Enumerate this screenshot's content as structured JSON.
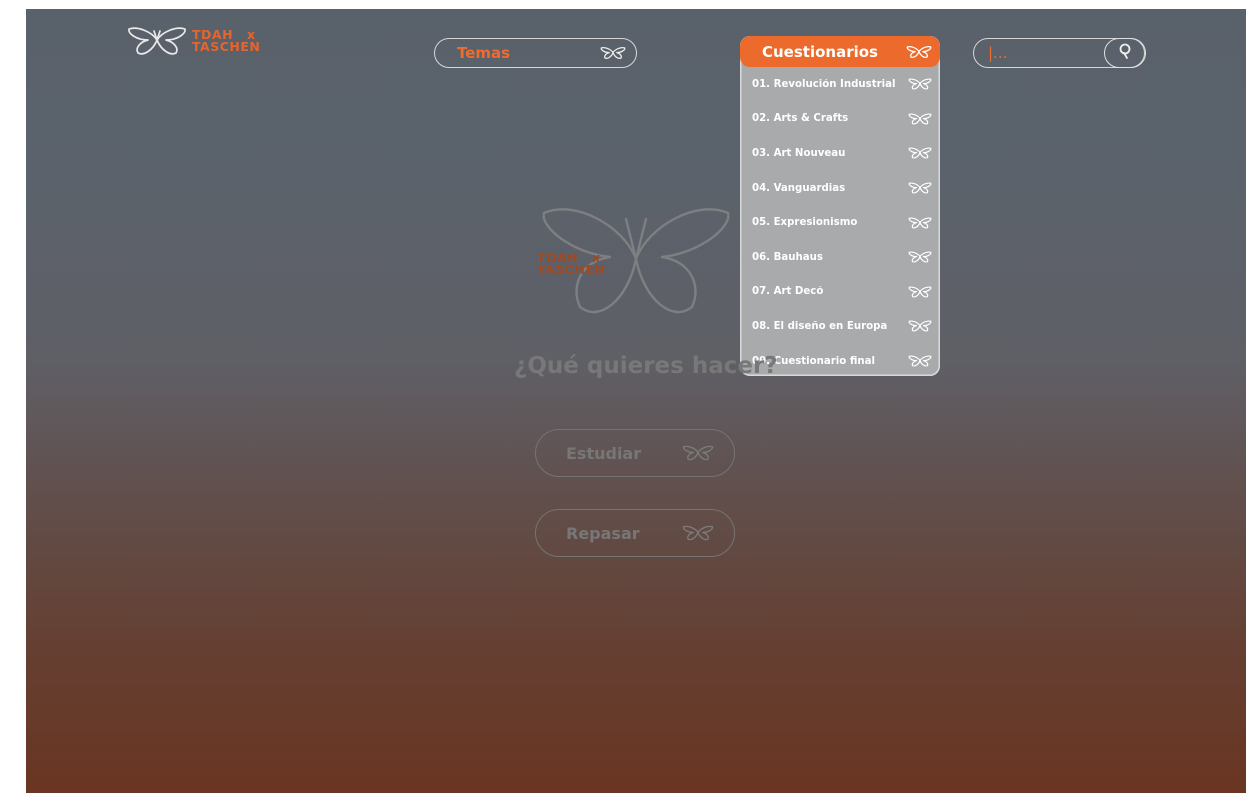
{
  "brand": {
    "line1": "TDAH",
    "x": "x",
    "line2": "TASCHEN"
  },
  "nav": {
    "temas_label": "Temas",
    "cuestionarios_label": "Cuestionarios",
    "cuestionarios_items": [
      {
        "label": "01. Revolución Industrial"
      },
      {
        "label": "02. Arts & Crafts"
      },
      {
        "label": "03. Art Nouveau"
      },
      {
        "label": "04. Vanguardias"
      },
      {
        "label": "05. Expresionismo"
      },
      {
        "label": "06. Bauhaus"
      },
      {
        "label": "07. Art Decó"
      },
      {
        "label": "08. El diseño en Europa"
      },
      {
        "label": "09. Cuestionario final"
      }
    ],
    "search_value": "|..."
  },
  "main": {
    "question": "¿Qué quieres hacer?",
    "study_label": "Estudiar",
    "review_label": "Repasar"
  },
  "colors": {
    "accent": "#ec6a2b",
    "background_top": "#59616b",
    "background_bottom": "#6a3522",
    "dropdown_bg": "#a9aaab"
  },
  "icons": {
    "butterfly": "butterfly-icon",
    "search": "search-icon"
  }
}
